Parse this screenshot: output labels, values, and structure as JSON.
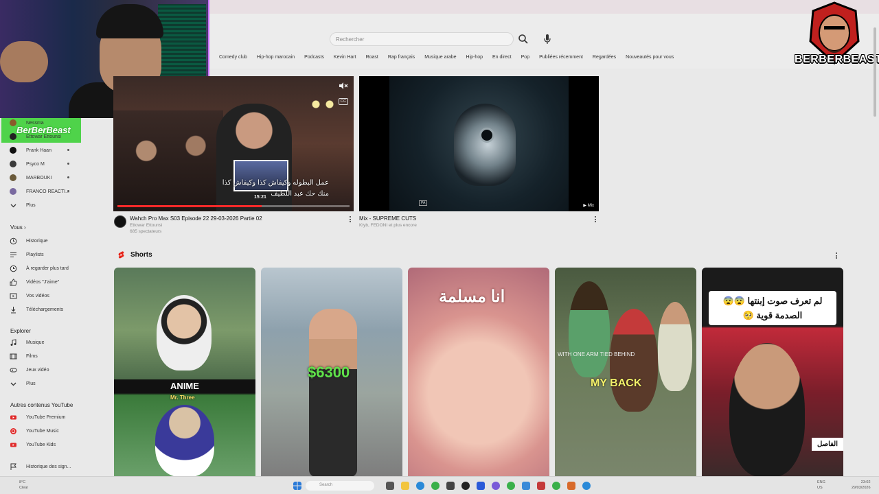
{
  "search": {
    "placeholder": "Rechercher"
  },
  "chips": [
    "Comedy club",
    "Hip-hop marocain",
    "Podcasts",
    "Kevin Hart",
    "Roast",
    "Rap français",
    "Musique arabe",
    "Hip-hop",
    "En direct",
    "Pop",
    "Publiées récemment",
    "Regardées",
    "Nouveautés pour vous"
  ],
  "overlay": {
    "tag": "BerBerBeast",
    "logo_text": "BERBERBEAST"
  },
  "subscriptions": [
    {
      "name": "Nessma"
    },
    {
      "name": "Ettowar Ettounsi"
    },
    {
      "name": "Prank Haan"
    },
    {
      "name": "Psyco M"
    },
    {
      "name": "MARBOUKI"
    },
    {
      "name": "FRANCO REACTI..."
    }
  ],
  "sidebar": {
    "more_subs": "Plus",
    "you_label": "Vous",
    "you_items": [
      "Historique",
      "Playlists",
      "À regarder plus tard",
      "Vidéos \"J'aime\"",
      "Vos vidéos",
      "Téléchargements"
    ],
    "explore_label": "Explorer",
    "explore_items": [
      "Musique",
      "Films",
      "Jeux vidéo",
      "Plus"
    ],
    "other_label": "Autres contenus YouTube",
    "other_items": [
      "YouTube Premium",
      "YouTube Music",
      "YouTube Kids"
    ],
    "bottom_item": "Historique des sign..."
  },
  "videos": [
    {
      "title": "Wahch Pro Max S03 Episode 22 29-03-2026 Partie 02",
      "channel": "Ettowar Ettounsi",
      "meta": "685 spectateurs",
      "subtitle_line1": "عمل البطوله وكيفاش كذا وكيفاش كذا",
      "subtitle_line2": "منك حك عبد اللطيف",
      "preview_time": "15:21",
      "progress": 0.62
    },
    {
      "title": "Mix - SUPREME CUTS",
      "channel": "Ktyb, FEDONI et plus encore",
      "badge": "Mix"
    }
  ],
  "shorts": {
    "heading": "Shorts",
    "items": [
      {
        "overlay": "ANIME",
        "overlay2": "Mr. Three"
      },
      {
        "overlay": "$6300"
      },
      {
        "overlay": "انا مسلمة"
      },
      {
        "overlay_small": "WITH ONE ARM TIED BEHIND",
        "overlay": "MY BACK"
      },
      {
        "overlay": "لم تعرف صوت إبنتها 😨😨 الصدمة قوية 🥺",
        "channel_tag": "الفاصل"
      }
    ]
  },
  "taskbar": {
    "search": "Search",
    "weather": "8°C",
    "weather2": "Clear",
    "lang": "ENG",
    "lang2": "US",
    "time": "23:02",
    "date": "29/03/2026"
  },
  "colors": {
    "accent": "#ff0000",
    "tag_green": "#4fd34a",
    "logo_red": "#c0201e"
  }
}
